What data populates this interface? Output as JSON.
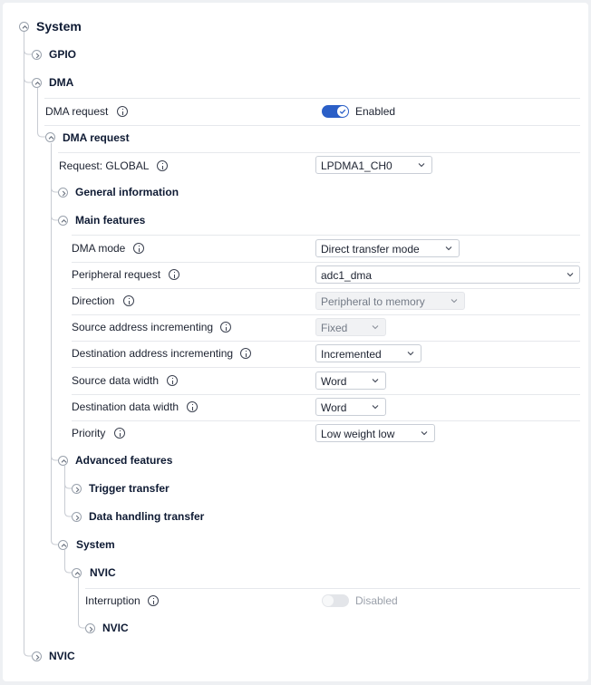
{
  "colors": {
    "accent": "#2b5fc7",
    "toggle_off": "#e3e5e9",
    "text": "#1c2230",
    "heading": "#0e1a33",
    "disabled_text": "#9aa0aa"
  },
  "tree": {
    "system": "System",
    "gpio": "GPIO",
    "dma": "DMA",
    "dma_request_param": {
      "label": "DMA request",
      "state": "Enabled"
    },
    "dma_request_node": "DMA request",
    "request_param": {
      "label": "Request: GLOBAL",
      "value": "LPDMA1_CH0"
    },
    "general_information": "General information",
    "main_features": "Main features",
    "dma_mode": {
      "label": "DMA mode",
      "value": "Direct transfer mode"
    },
    "peripheral_request": {
      "label": "Peripheral request",
      "value": "adc1_dma"
    },
    "direction": {
      "label": "Direction",
      "value": "Peripheral to memory"
    },
    "src_addr_inc": {
      "label": "Source address incrementing",
      "value": "Fixed"
    },
    "dst_addr_inc": {
      "label": "Destination address incrementing",
      "value": "Incremented"
    },
    "src_data_width": {
      "label": "Source data width",
      "value": "Word"
    },
    "dst_data_width": {
      "label": "Destination data width",
      "value": "Word"
    },
    "priority": {
      "label": "Priority",
      "value": "Low weight low"
    },
    "advanced_features": "Advanced features",
    "trigger_transfer": "Trigger transfer",
    "data_handling_transfer": "Data handling transfer",
    "system_sub": "System",
    "nvic_sub": "NVIC",
    "interruption": {
      "label": "Interruption",
      "state": "Disabled"
    },
    "nvic_leaf": "NVIC",
    "nvic_root": "NVIC"
  }
}
